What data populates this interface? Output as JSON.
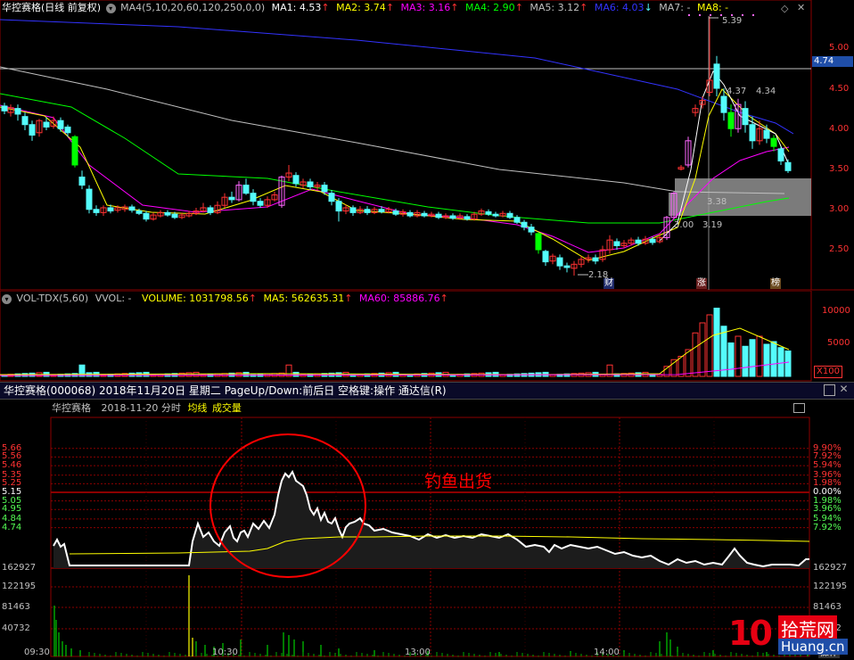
{
  "kline_header": {
    "stock_title": "华控赛格(日线 前复权)",
    "ma_set": "MA4(5,10,20,60,120,250,0,0)",
    "ma1": "MA1: 4.53",
    "ma2": "MA2: 3.74",
    "ma3": "MA3: 3.16",
    "ma4": "MA4: 2.90",
    "ma5": "MA5: 3.12",
    "ma6": "MA6: 4.03",
    "ma7": "MA7: -",
    "ma8": "MA8: -"
  },
  "kline_axis": [
    "5.00",
    "4.50",
    "4.00",
    "3.50",
    "3.00",
    "2.50"
  ],
  "price_tag": "4.74",
  "annotations": {
    "high": "5.39",
    "low": "2.18",
    "mid1": "4.37",
    "mid2": "4.34",
    "box1": "3.38",
    "box2": "3.19",
    "box3": "3.00",
    "mark_cai": "财",
    "mark_zhang": "涨",
    "mark_bang": "榜"
  },
  "vol_header": {
    "name": "VOL-TDX(5,60)",
    "vvol": "VVOL: -",
    "volume": "VOLUME: 1031798.56",
    "ma5": "MA5: 562635.31",
    "ma60": "MA60: 85886.76"
  },
  "vol_axis": [
    "10000",
    "5000"
  ],
  "vol_unit": "X100",
  "window_title": "华控赛格(000068) 2018年11月20日 星期二 PageUp/Down:前后日 空格键:操作 通达信(R)",
  "intraday_header": {
    "name": "华控赛格",
    "date": "2018-11-20 分时",
    "avg_line": "均线",
    "volume": "成交量"
  },
  "intraday_left_axis": [
    "5.66",
    "5.56",
    "5.46",
    "5.35",
    "5.25",
    "5.15",
    "5.05",
    "4.95",
    "4.84",
    "4.74",
    "162927",
    "122195",
    "81463",
    "40732"
  ],
  "intraday_right_axis": [
    "9.90%",
    "7.92%",
    "5.94%",
    "3.96%",
    "1.98%",
    "0.00%",
    "1.98%",
    "3.96%",
    "5.94%",
    "7.92%",
    "162927",
    "122195",
    "81463",
    "40732"
  ],
  "time_axis": [
    "09:30",
    "10:30",
    "13:00",
    "14:00",
    "15:00"
  ],
  "annotation_text": "钓鱼出货",
  "operate_label": "操作",
  "watermark": {
    "digits": "10",
    "cn": "拾荒网",
    "url": "Huang.cn"
  },
  "colors": {
    "up": "#ff3232",
    "down": "#54fcfc",
    "ma1": "#ffffff",
    "ma2": "#ffff00",
    "ma3": "#ff00ff",
    "ma4": "#00ff00",
    "ma5": "#c0c0c0",
    "ma6": "#3333ff",
    "accent": "#ff0000"
  }
}
